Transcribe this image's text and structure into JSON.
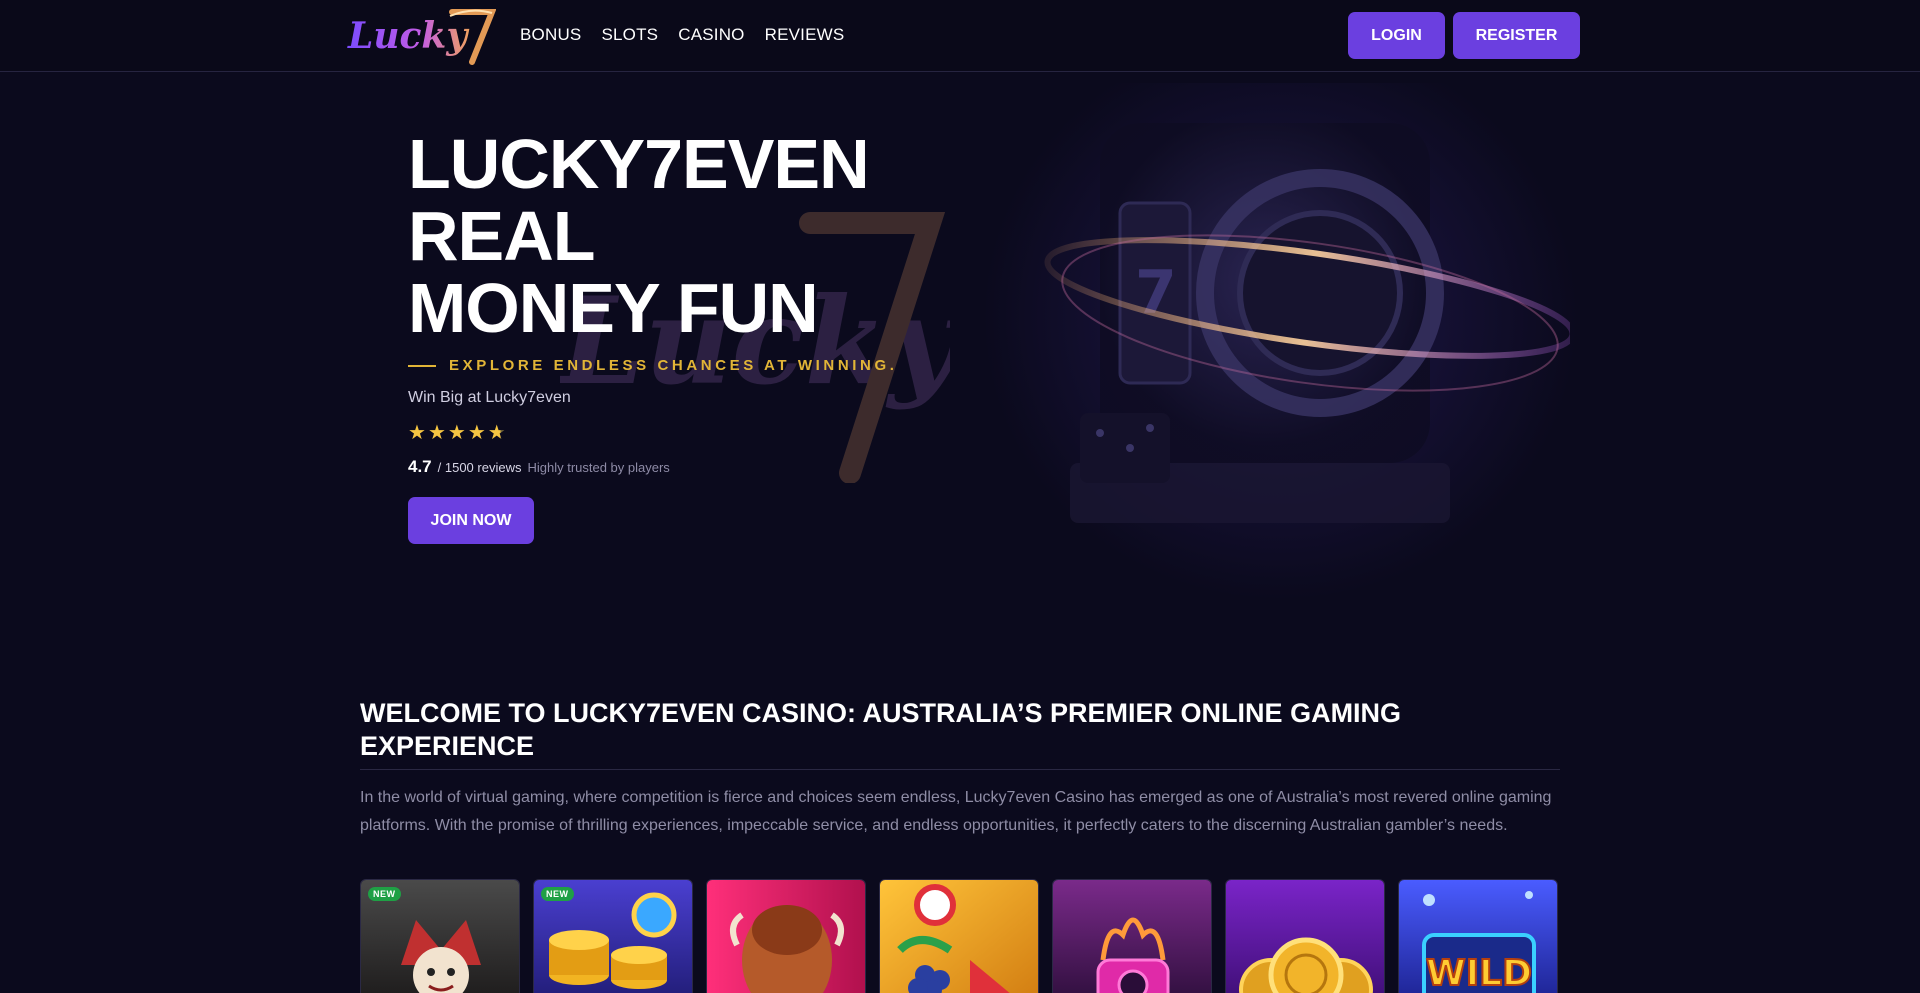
{
  "header": {
    "logo_text": "Lucky7",
    "nav": [
      "BONUS",
      "SLOTS",
      "CASINO",
      "REVIEWS"
    ],
    "login_label": "LOGIN",
    "register_label": "REGISTER"
  },
  "hero": {
    "title_lines": [
      "LUCKY7EVEN",
      "REAL",
      "MONEY FUN"
    ],
    "tagline": "EXPLORE ENDLESS CHANCES AT WINNING.",
    "subtitle": "Win Big at Lucky7even",
    "stars": 4.7,
    "rating_score": "4.7",
    "rating_count": "/ 1500 reviews",
    "rating_trust": "Highly trusted by players",
    "join_label": "JOIN NOW"
  },
  "welcome": {
    "title": "WELCOME TO LUCKY7EVEN CASINO: AUSTRALIA’S PREMIER ONLINE GAMING EXPERIENCE",
    "text": "In the world of virtual gaming, where competition is fierce and choices seem endless, Lucky7even Casino has emerged as one of Australia’s most revered online gaming platforms. With the promise of thrilling experiences, impeccable service, and endless opportunities, it perfectly caters to the discerning Australian gambler’s needs."
  },
  "games": [
    {
      "name": "jester",
      "badge": "NEW",
      "colors": [
        "#3a3a3a",
        "#1d1b1b"
      ]
    },
    {
      "name": "gold-coins",
      "badge": "NEW",
      "colors": [
        "#3d3ab8",
        "#1b1a6e"
      ]
    },
    {
      "name": "buffalo",
      "badge": "",
      "colors": [
        "#e0206a",
        "#8a1040"
      ]
    },
    {
      "name": "fruits",
      "badge": "",
      "colors": [
        "#f2a51c",
        "#c56a0e"
      ]
    },
    {
      "name": "neon-skull",
      "badge": "",
      "colors": [
        "#5b1b6e",
        "#2b0d3a"
      ]
    },
    {
      "name": "gold-coins-purple",
      "badge": "",
      "colors": [
        "#6a1fb0",
        "#3a0d70"
      ]
    },
    {
      "name": "wild",
      "badge": "",
      "colors": [
        "#3a4ae6",
        "#1b1f8a"
      ]
    }
  ]
}
